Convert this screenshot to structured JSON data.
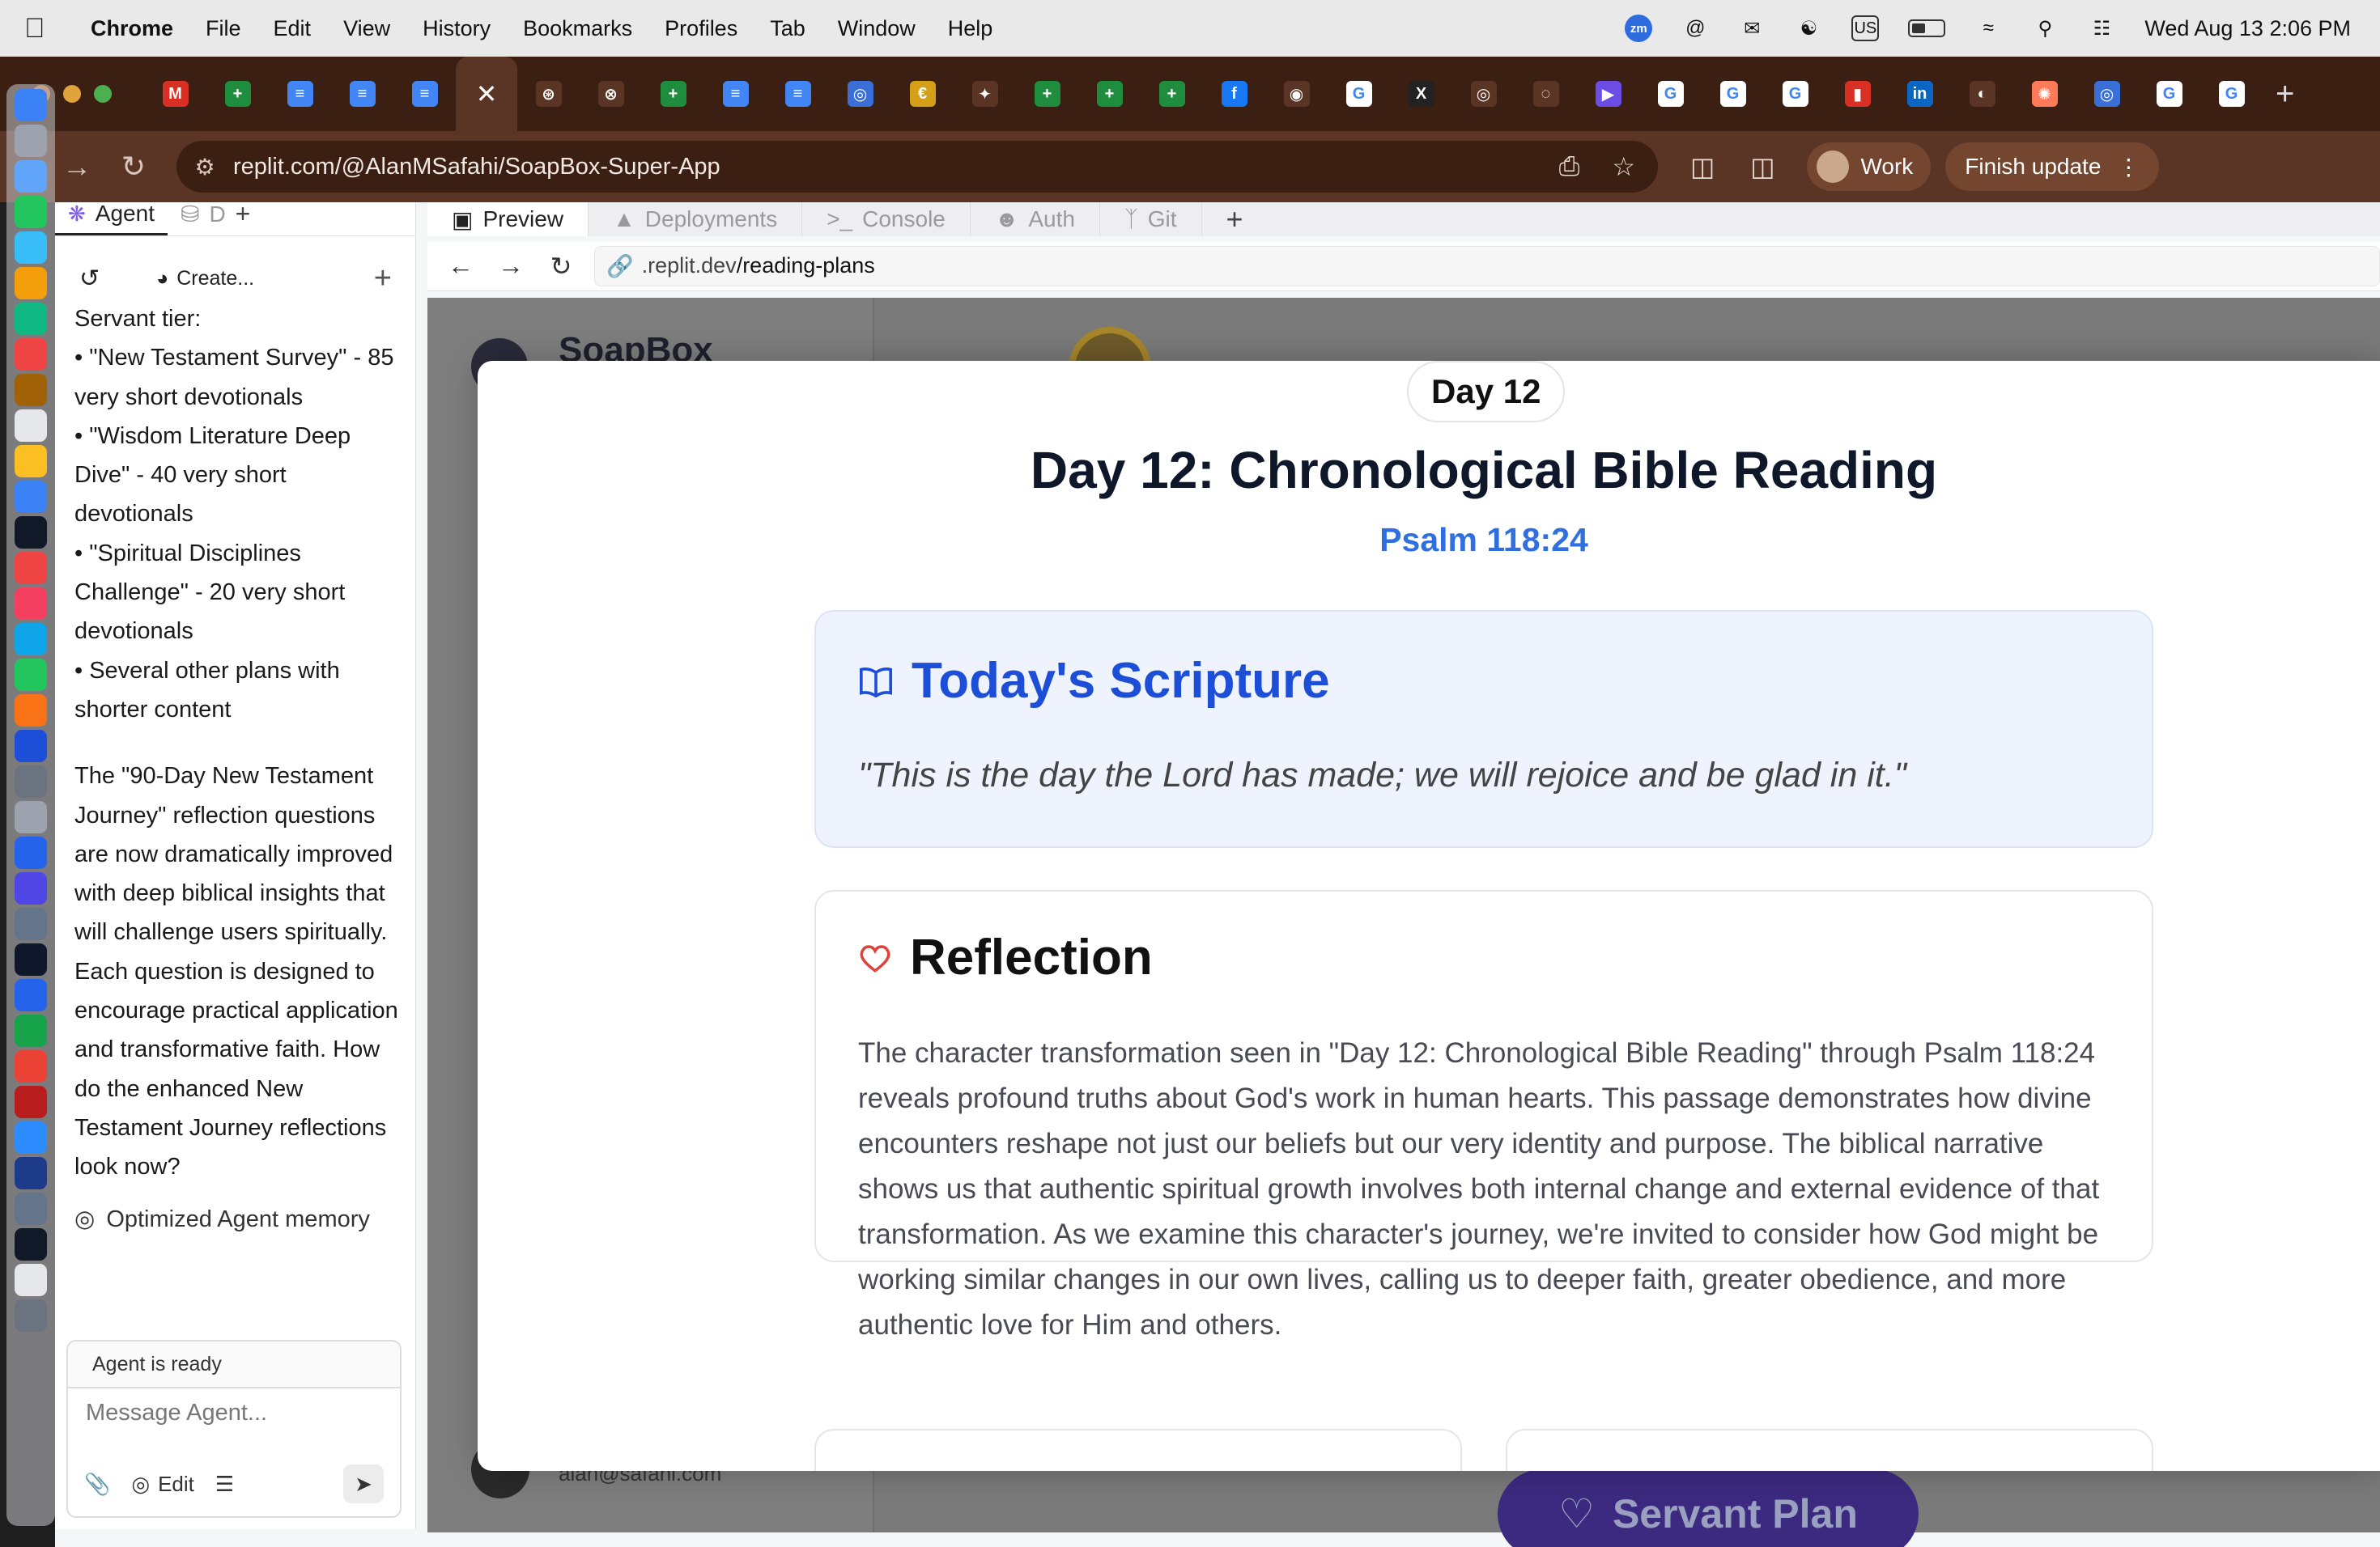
{
  "menubar": {
    "app": "Chrome",
    "items": [
      "File",
      "Edit",
      "View",
      "History",
      "Bookmarks",
      "Profiles",
      "Tab",
      "Window",
      "Help"
    ],
    "status_icons": [
      "zoom-icon",
      "at-icon",
      "outlook-icon",
      "teams-icon",
      "keyboard-icon",
      "battery-icon",
      "wifi-icon",
      "search-icon",
      "control-center-icon"
    ],
    "input_source": "US",
    "zoom_label": "zm",
    "datetime": "Wed Aug 13  2:06 PM"
  },
  "browser": {
    "url": "replit.com/@AlanMSafahi/SoapBox-Super-App",
    "profile_label": "Work",
    "update_label": "Finish update",
    "tabs": [
      {
        "icon": "gmail-icon",
        "color": "#d93025",
        "glyph": "M"
      },
      {
        "icon": "sheets-icon",
        "color": "#1e8e3e",
        "glyph": "+"
      },
      {
        "icon": "docs-icon",
        "color": "#4285f4",
        "glyph": "≡"
      },
      {
        "icon": "docs-icon",
        "color": "#4285f4",
        "glyph": "≡"
      },
      {
        "icon": "docs-icon",
        "color": "#4285f4",
        "glyph": "≡"
      },
      {
        "icon": "close-icon",
        "color": "transparent",
        "glyph": "✕"
      },
      {
        "icon": "openai-icon",
        "color": "#5a3424",
        "glyph": "⊛"
      },
      {
        "icon": "x-circle-icon",
        "color": "#5a3424",
        "glyph": "⊗"
      },
      {
        "icon": "sheets-icon",
        "color": "#1e8e3e",
        "glyph": "+"
      },
      {
        "icon": "docs-icon",
        "color": "#4285f4",
        "glyph": "≡"
      },
      {
        "icon": "docs-icon",
        "color": "#4285f4",
        "glyph": "≡"
      },
      {
        "icon": "globe-icon",
        "color": "#3b6fd8",
        "glyph": "◎"
      },
      {
        "icon": "coin-icon",
        "color": "#d4a017",
        "glyph": "€"
      },
      {
        "icon": "gemini-icon",
        "color": "#5a3424",
        "glyph": "✦"
      },
      {
        "icon": "sheets-icon",
        "color": "#1e8e3e",
        "glyph": "+"
      },
      {
        "icon": "sheets-icon",
        "color": "#1e8e3e",
        "glyph": "+"
      },
      {
        "icon": "sheets-icon",
        "color": "#1e8e3e",
        "glyph": "+"
      },
      {
        "icon": "facebook-icon",
        "color": "#1877f2",
        "glyph": "f"
      },
      {
        "icon": "github-icon",
        "color": "#5a3424",
        "glyph": "◉"
      },
      {
        "icon": "google-icon",
        "color": "#ffffff",
        "glyph": "G"
      },
      {
        "icon": "x-icon",
        "color": "#222222",
        "glyph": "X"
      },
      {
        "icon": "circle-icon",
        "color": "#5a3424",
        "glyph": "◎"
      },
      {
        "icon": "ring-icon",
        "color": "#5a3424",
        "glyph": "◌"
      },
      {
        "icon": "play-icon",
        "color": "#6b4de6",
        "glyph": "▶"
      },
      {
        "icon": "google-icon",
        "color": "#ffffff",
        "glyph": "G"
      },
      {
        "icon": "google-icon",
        "color": "#ffffff",
        "glyph": "G"
      },
      {
        "icon": "google-icon",
        "color": "#ffffff",
        "glyph": "G"
      },
      {
        "icon": "bookmark-icon",
        "color": "#d93025",
        "glyph": "▮"
      },
      {
        "icon": "linkedin-icon",
        "color": "#0a66c2",
        "glyph": "in"
      },
      {
        "icon": "globe-icon",
        "color": "#5a3424",
        "glyph": "◐"
      },
      {
        "icon": "hubspot-icon",
        "color": "#ff7a59",
        "glyph": "✺"
      },
      {
        "icon": "globe-icon",
        "color": "#3b6fd8",
        "glyph": "◎"
      },
      {
        "icon": "google-icon",
        "color": "#ffffff",
        "glyph": "G"
      },
      {
        "icon": "google-icon",
        "color": "#ffffff",
        "glyph": "G"
      }
    ]
  },
  "agent": {
    "tab_agent": "Agent",
    "tab_db": "D",
    "create_label": "Create...",
    "chat_lines": [
      "Servant tier:",
      "• \"New Testament Survey\" - 85 very short devotionals",
      "• \"Wisdom Literature Deep Dive\" - 40 very short devotionals",
      "• \"Spiritual Disciplines Challenge\" - 20 very short devotionals",
      "• Several other plans with shorter content"
    ],
    "chat_paragraph": "The \"90-Day New Testament Journey\" reflection questions are now dramatically improved with deep biblical insights that will challenge users spiritually. Each question is designed to encourage practical application and transformative faith. How do the enhanced New Testament Journey reflections look now?",
    "memory_label": "Optimized Agent memory",
    "status": "Agent is ready",
    "input_placeholder": "Message Agent...",
    "edit_label": "Edit"
  },
  "preview": {
    "tabs": [
      "Preview",
      "Deployments",
      "Console",
      "Auth",
      "Git"
    ],
    "url_prefix": ".replit.dev",
    "url_path": "/reading-plans"
  },
  "app": {
    "name": "SoapBox",
    "email": "alan@safahi.com",
    "servant_button": "Servant Plan"
  },
  "modal": {
    "day_badge": "Day 12",
    "title": "Day 12: Chronological Bible Reading",
    "reference": "Psalm 118:24",
    "scripture_heading": "Today's Scripture",
    "scripture_quote": "\"This is the day the Lord has made; we will rejoice and be glad in it.\"",
    "reflection_heading": "Reflection",
    "reflection_body": "The character transformation seen in \"Day 12: Chronological Bible Reading\" through Psalm 118:24 reveals profound truths about God's work in human hearts. This passage demonstrates how divine encounters reshape not just our beliefs but our very identity and purpose. The biblical narrative shows us that authentic spiritual growth involves both internal change and external evidence of that transformation. As we examine this character's journey, we're invited to consider how God might be working similar changes in our own lives, calling us to deeper faith, greater obedience, and more authentic love for Him and others."
  }
}
